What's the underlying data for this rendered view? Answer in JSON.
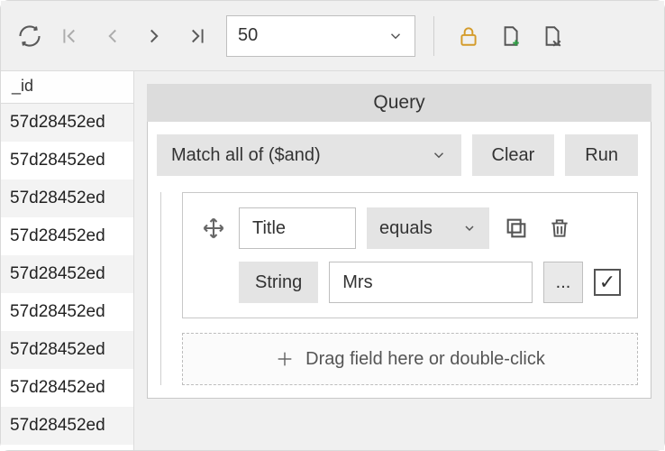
{
  "toolbar": {
    "page_size": "50"
  },
  "grid": {
    "header": "_id",
    "rows": [
      "57d28452ed",
      "57d28452ed",
      "57d28452ed",
      "57d28452ed",
      "57d28452ed",
      "57d28452ed",
      "57d28452ed",
      "57d28452ed",
      "57d28452ed"
    ]
  },
  "query": {
    "title": "Query",
    "match_label": "Match all of ($and)",
    "clear_label": "Clear",
    "run_label": "Run",
    "rule": {
      "field": "Title",
      "operator": "equals",
      "type": "String",
      "value": "Mrs",
      "more": "...",
      "enabled_check": "✓"
    },
    "drop_hint": "Drag field here or double-click"
  }
}
